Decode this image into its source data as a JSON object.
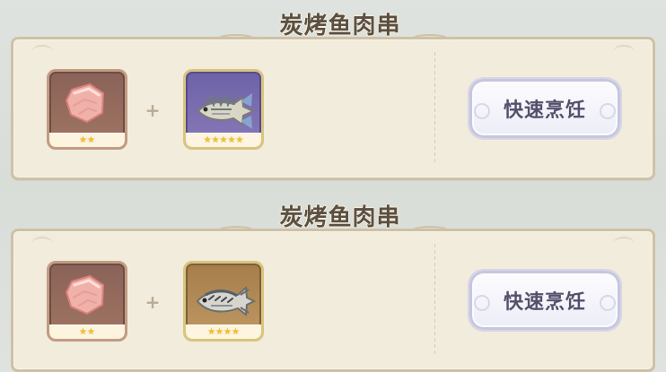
{
  "colors": {
    "background": "#dfe3df",
    "card_fill": "#f2ecdc",
    "card_border": "#cfc1a6",
    "title_text": "#5b4f43",
    "button_text": "#55506b",
    "star": "#f3bf27",
    "tile_meat": "#8a6258",
    "tile_fish_5": "#6d62a7",
    "tile_fish_4": "#a47d4b"
  },
  "recipes": [
    {
      "title": "炭烤鱼肉串",
      "plus": "+",
      "button_label": "快速烹饪",
      "ingredients": [
        {
          "icon": "raw-meat-icon",
          "rarity": 2,
          "stars": "★★"
        },
        {
          "icon": "spiny-fish-icon",
          "rarity": 5,
          "stars": "★★★★★"
        }
      ]
    },
    {
      "title": "炭烤鱼肉串",
      "plus": "+",
      "button_label": "快速烹饪",
      "ingredients": [
        {
          "icon": "raw-meat-icon",
          "rarity": 2,
          "stars": "★★"
        },
        {
          "icon": "bass-fish-icon",
          "rarity": 4,
          "stars": "★★★★"
        }
      ]
    }
  ]
}
